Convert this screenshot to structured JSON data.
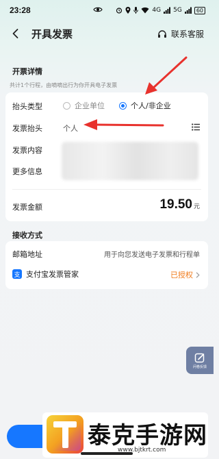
{
  "status_bar": {
    "time": "23:28",
    "signal_1": "4G",
    "signal_2": "5G",
    "battery": "60"
  },
  "header": {
    "title": "开具发票",
    "customer_service": "联系客服"
  },
  "details": {
    "section_title": "开票详情",
    "hint": "共计1个行程，由嘀嘀出行为你开具电子发票",
    "title_type_label": "抬头类型",
    "option_company": "企业单位",
    "option_personal": "个人/非企业",
    "selected": "个人/非企业",
    "invoice_title_label": "发票抬头",
    "invoice_title_value": "个人",
    "content_label": "发票内容",
    "more_info_label": "更多信息",
    "amount_label": "发票金额",
    "amount_value": "19.50",
    "amount_unit": "元"
  },
  "receive": {
    "section_title": "接收方式",
    "email_label": "邮箱地址",
    "email_placeholder": "用于向您发送电子发票和行程单",
    "alipay_icon_text": "支",
    "alipay_label": "支付宝发票管家",
    "authorized_label": "已授权"
  },
  "feedback": {
    "label": "问卷反馈"
  },
  "watermark": {
    "text": "泰克手游网",
    "url": "www.bjtkrt.com"
  },
  "colors": {
    "accent": "#1677ff",
    "arrow": "#e8322d",
    "authorized": "#f07a1a"
  }
}
